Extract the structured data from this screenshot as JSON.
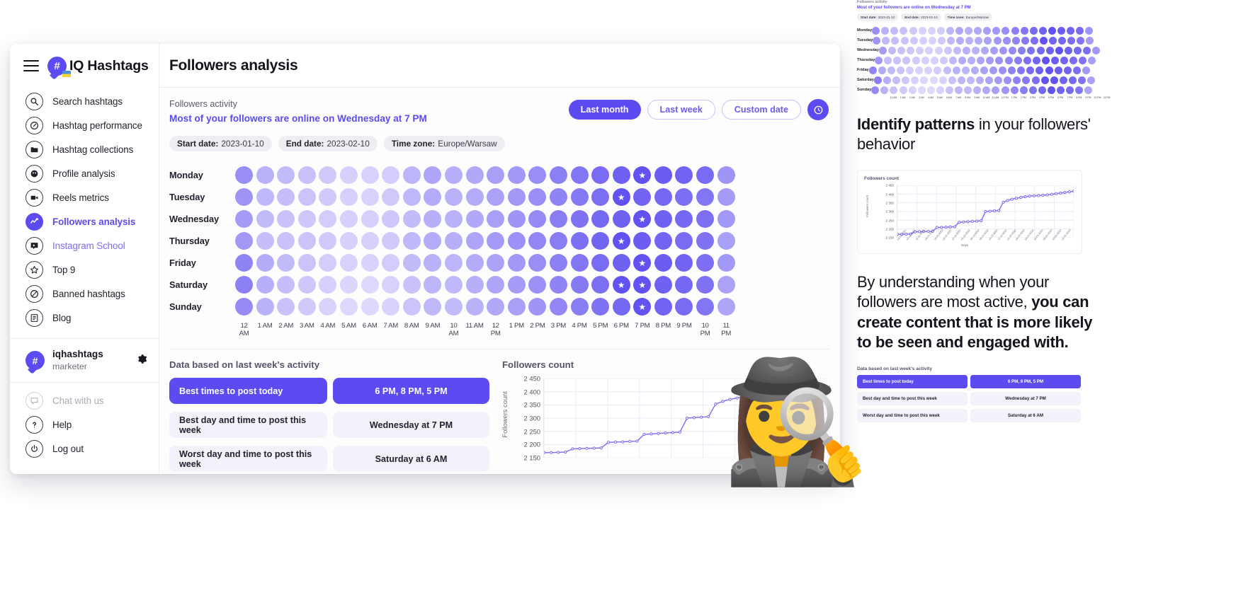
{
  "brand": {
    "name_iq": "IQ",
    "name_hashtags": "Hashtags",
    "badge": "#"
  },
  "sidebar": {
    "items": [
      {
        "label": "Search hashtags",
        "icon": "search-icon",
        "state": "normal"
      },
      {
        "label": "Hashtag performance",
        "icon": "gauge-icon",
        "state": "normal"
      },
      {
        "label": "Hashtag collections",
        "icon": "folder-icon",
        "state": "normal"
      },
      {
        "label": "Profile analysis",
        "icon": "profile-icon",
        "state": "normal"
      },
      {
        "label": "Reels metrics",
        "icon": "video-icon",
        "state": "normal"
      },
      {
        "label": "Followers analysis",
        "icon": "activity-icon",
        "state": "active"
      },
      {
        "label": "Instagram School",
        "icon": "school-icon",
        "state": "link"
      },
      {
        "label": "Top 9",
        "icon": "star-icon",
        "state": "normal"
      },
      {
        "label": "Banned hashtags",
        "icon": "ban-icon",
        "state": "normal"
      },
      {
        "label": "Blog",
        "icon": "blog-icon",
        "state": "normal"
      }
    ],
    "account": {
      "name": "iqhashtags",
      "role": "marketer",
      "badge": "#",
      "settings_icon": "gear-icon"
    },
    "footer": [
      {
        "label": "Chat with us",
        "icon": "chat-icon",
        "state": "muted"
      },
      {
        "label": "Help",
        "icon": "help-icon",
        "state": "normal"
      },
      {
        "label": "Log out",
        "icon": "power-icon",
        "state": "normal"
      }
    ]
  },
  "header": {
    "title": "Followers analysis"
  },
  "activity": {
    "kicker": "Followers activity",
    "headline": "Most of your followers are online on Wednesday at 7 PM",
    "buttons": [
      {
        "label": "Last month",
        "style": "solid"
      },
      {
        "label": "Last week",
        "style": "ghost"
      },
      {
        "label": "Custom date",
        "style": "ghost"
      }
    ],
    "clock_icon": "clock-icon",
    "chips": [
      {
        "key": "Start date:",
        "value": "2023-01-10"
      },
      {
        "key": "End date:",
        "value": "2023-02-10"
      },
      {
        "key": "Time zone:",
        "value": "Europe/Warsaw"
      }
    ]
  },
  "chart_data": {
    "heatmap": {
      "type": "heatmap",
      "title": "Followers activity",
      "days": [
        "Monday",
        "Tuesday",
        "Wednesday",
        "Thursday",
        "Friday",
        "Saturday",
        "Sunday"
      ],
      "hours": [
        "12 AM",
        "1 AM",
        "2 AM",
        "3 AM",
        "4 AM",
        "5 AM",
        "6 AM",
        "7 AM",
        "8 AM",
        "9 AM",
        "10 AM",
        "11 AM",
        "12 PM",
        "1 PM",
        "2 PM",
        "3 PM",
        "4 PM",
        "5 PM",
        "6 PM",
        "7 PM",
        "8 PM",
        "9 PM",
        "10 PM",
        "11 PM"
      ],
      "values": [
        [
          62,
          40,
          34,
          30,
          24,
          20,
          18,
          22,
          38,
          48,
          42,
          46,
          52,
          56,
          62,
          70,
          76,
          82,
          88,
          96,
          90,
          86,
          82,
          58
        ],
        [
          58,
          36,
          32,
          28,
          24,
          20,
          18,
          24,
          36,
          44,
          40,
          44,
          50,
          56,
          62,
          68,
          74,
          80,
          96,
          86,
          84,
          80,
          76,
          54
        ],
        [
          54,
          34,
          30,
          26,
          22,
          20,
          20,
          26,
          34,
          42,
          40,
          46,
          52,
          58,
          64,
          72,
          78,
          84,
          88,
          96,
          88,
          84,
          80,
          56
        ],
        [
          56,
          32,
          30,
          28,
          24,
          20,
          20,
          24,
          36,
          44,
          42,
          48,
          54,
          60,
          66,
          72,
          80,
          86,
          96,
          90,
          86,
          82,
          78,
          52
        ],
        [
          68,
          44,
          34,
          28,
          22,
          18,
          18,
          22,
          34,
          40,
          38,
          44,
          50,
          56,
          62,
          70,
          76,
          82,
          88,
          96,
          90,
          86,
          80,
          56
        ],
        [
          70,
          42,
          32,
          26,
          20,
          16,
          14,
          18,
          30,
          38,
          36,
          42,
          48,
          54,
          60,
          68,
          74,
          80,
          96,
          96,
          88,
          84,
          78,
          50
        ],
        [
          64,
          40,
          30,
          24,
          18,
          14,
          14,
          18,
          28,
          36,
          34,
          40,
          46,
          52,
          58,
          66,
          72,
          78,
          84,
          96,
          86,
          82,
          76,
          48
        ]
      ],
      "stars": [
        [
          0,
          19
        ],
        [
          1,
          18
        ],
        [
          2,
          19
        ],
        [
          3,
          18
        ],
        [
          4,
          19
        ],
        [
          5,
          18
        ],
        [
          5,
          19
        ],
        [
          6,
          19
        ]
      ],
      "colorscale": {
        "low": "#ece9fe",
        "high": "#5b4bf0"
      }
    },
    "followers_count": {
      "type": "line",
      "title": "Followers count",
      "ylabel": "Followers count",
      "xlabel": "Days",
      "yticks": [
        "2 450",
        "2 400",
        "2 350",
        "2 300",
        "2 250",
        "2 200",
        "2 150"
      ],
      "ylim": [
        2130,
        2470
      ],
      "x": [
        "03-11-2022",
        "07-11-2022",
        "11-11-2022",
        "15-11-2022",
        "19-11-2022",
        "23-11-2022",
        "27-11-2022",
        "01-12-2022",
        "05-12-2022",
        "09-12-2022",
        "13-12-2022",
        "17-12-2022",
        "21-12-2022",
        "25-12-2022",
        "29-12-2022",
        "02-01-2023",
        "06-01-2023",
        "10-01-2023",
        "14-01-2023"
      ],
      "values": [
        2152,
        2152,
        2153,
        2154,
        2168,
        2169,
        2170,
        2171,
        2172,
        2196,
        2197,
        2198,
        2200,
        2201,
        2230,
        2232,
        2234,
        2236,
        2238,
        2240,
        2300,
        2302,
        2304,
        2306,
        2360,
        2372,
        2380,
        2386,
        2392,
        2396,
        2400,
        2402,
        2404,
        2406,
        2408,
        2412,
        2416,
        2420,
        2424,
        2428,
        2432
      ],
      "line_color": "#7c6bf5",
      "grid": true
    }
  },
  "insights": {
    "section_title": "Data based on last week's activity",
    "rows": [
      {
        "label": "Best times to post today",
        "value": "6 PM, 8 PM, 5 PM",
        "highlight": true
      },
      {
        "label": "Best day and time to post this week",
        "value": "Wednesday at 7 PM",
        "highlight": false
      },
      {
        "label": "Worst day and time to post this week",
        "value": "Saturday at 6 AM",
        "highlight": false
      }
    ]
  },
  "marketing": {
    "copy1_bold": "Identify patterns",
    "copy1_rest": " in your followers' behavior",
    "copy2_plain": "By understanding when your followers are most active, ",
    "copy2_bold": "you can create content that is more likely to be seen and engaged with."
  },
  "decor": {
    "detective_emoji": "🕵️‍♀️"
  },
  "colors": {
    "accent": "#5b4bf0",
    "accent_soft": "#7c6bf5",
    "chip_bg": "#eeeef2",
    "row_bg": "#f3f2fb"
  }
}
